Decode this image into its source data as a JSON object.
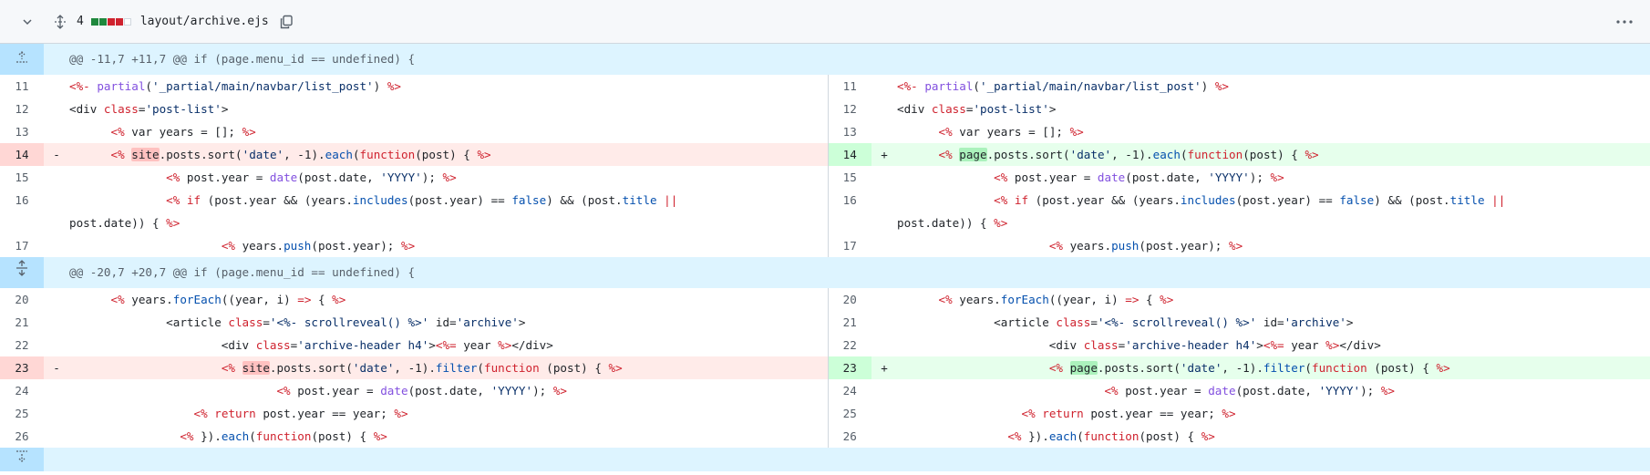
{
  "file": {
    "changes_count": "4",
    "diffstat": [
      "#1f883d",
      "#1f883d",
      "#cf222e",
      "#cf222e",
      "#ffffff"
    ],
    "path": "layout/archive.ejs"
  },
  "colors": {
    "hunk_bg": "#ddf4ff",
    "del_bg": "#ffebe9",
    "add_bg": "#e6ffec",
    "del_num_bg": "#ffd7d5",
    "add_num_bg": "#ccffd8"
  },
  "hunks": [
    {
      "header": "@@ -11,7 +11,7 @@ if (page.menu_id == undefined) {",
      "rows": [
        {
          "type": "ctx",
          "ln": "11",
          "rn": "11",
          "left": [
            [
              "k",
              "<%-"
            ],
            [
              "p",
              " "
            ],
            [
              "f",
              "partial"
            ],
            [
              "p",
              "("
            ],
            [
              "s",
              "'_partial/main/navbar/list_post'"
            ],
            [
              "p",
              ") "
            ],
            [
              "k",
              "%>"
            ]
          ],
          "right": [
            [
              "k",
              "<%-"
            ],
            [
              "p",
              " "
            ],
            [
              "f",
              "partial"
            ],
            [
              "p",
              "("
            ],
            [
              "s",
              "'_partial/main/navbar/list_post'"
            ],
            [
              "p",
              ") "
            ],
            [
              "k",
              "%>"
            ]
          ]
        },
        {
          "type": "ctx",
          "ln": "12",
          "rn": "12",
          "left": [
            [
              "p",
              "<div "
            ],
            [
              "k",
              "class"
            ],
            [
              "p",
              "="
            ],
            [
              "s",
              "'post-list'"
            ],
            [
              "p",
              ">"
            ]
          ],
          "right": [
            [
              "p",
              "<div "
            ],
            [
              "k",
              "class"
            ],
            [
              "p",
              "="
            ],
            [
              "s",
              "'post-list'"
            ],
            [
              "p",
              ">"
            ]
          ]
        },
        {
          "type": "ctx",
          "ln": "13",
          "rn": "13",
          "left": [
            [
              "p",
              "      "
            ],
            [
              "k",
              "<%"
            ],
            [
              "p",
              " var years = []; "
            ],
            [
              "k",
              "%>"
            ]
          ],
          "right": [
            [
              "p",
              "      "
            ],
            [
              "k",
              "<%"
            ],
            [
              "p",
              " var years = []; "
            ],
            [
              "k",
              "%>"
            ]
          ]
        },
        {
          "type": "mod",
          "ln": "14",
          "rn": "14",
          "left": [
            [
              "p",
              "      "
            ],
            [
              "k",
              "<%"
            ],
            [
              "p",
              " "
            ],
            [
              "hd",
              "site"
            ],
            [
              "p",
              ".posts.sort("
            ],
            [
              "s",
              "'date'"
            ],
            [
              "p",
              ", -1)."
            ],
            [
              "c",
              "each"
            ],
            [
              "p",
              "("
            ],
            [
              "k",
              "function"
            ],
            [
              "p",
              "(post) { "
            ],
            [
              "k",
              "%>"
            ]
          ],
          "right": [
            [
              "p",
              "      "
            ],
            [
              "k",
              "<%"
            ],
            [
              "p",
              " "
            ],
            [
              "ha",
              "page"
            ],
            [
              "p",
              ".posts.sort("
            ],
            [
              "s",
              "'date'"
            ],
            [
              "p",
              ", -1)."
            ],
            [
              "c",
              "each"
            ],
            [
              "p",
              "("
            ],
            [
              "k",
              "function"
            ],
            [
              "p",
              "(post) { "
            ],
            [
              "k",
              "%>"
            ]
          ]
        },
        {
          "type": "ctx",
          "ln": "15",
          "rn": "15",
          "left": [
            [
              "p",
              "              "
            ],
            [
              "k",
              "<%"
            ],
            [
              "p",
              " post.year = "
            ],
            [
              "f",
              "date"
            ],
            [
              "p",
              "(post.date, "
            ],
            [
              "s",
              "'YYYY'"
            ],
            [
              "p",
              "); "
            ],
            [
              "k",
              "%>"
            ]
          ],
          "right": [
            [
              "p",
              "              "
            ],
            [
              "k",
              "<%"
            ],
            [
              "p",
              " post.year = "
            ],
            [
              "f",
              "date"
            ],
            [
              "p",
              "(post.date, "
            ],
            [
              "s",
              "'YYYY'"
            ],
            [
              "p",
              "); "
            ],
            [
              "k",
              "%>"
            ]
          ]
        },
        {
          "type": "ctx2",
          "ln": "16",
          "rn": "16",
          "left": [
            [
              "p",
              "              "
            ],
            [
              "k",
              "<%"
            ],
            [
              "p",
              " "
            ],
            [
              "k",
              "if"
            ],
            [
              "p",
              " (post.year && (years."
            ],
            [
              "c",
              "includes"
            ],
            [
              "p",
              "(post.year) == "
            ],
            [
              "c",
              "false"
            ],
            [
              "p",
              ") && (post."
            ],
            [
              "c",
              "title"
            ],
            [
              "p",
              " "
            ],
            [
              "k",
              "||"
            ]
          ],
          "left2": [
            [
              "p",
              "post.date)) { "
            ],
            [
              "k",
              "%>"
            ]
          ],
          "right": [
            [
              "p",
              "              "
            ],
            [
              "k",
              "<%"
            ],
            [
              "p",
              " "
            ],
            [
              "k",
              "if"
            ],
            [
              "p",
              " (post.year && (years."
            ],
            [
              "c",
              "includes"
            ],
            [
              "p",
              "(post.year) == "
            ],
            [
              "c",
              "false"
            ],
            [
              "p",
              ") && (post."
            ],
            [
              "c",
              "title"
            ],
            [
              "p",
              " "
            ],
            [
              "k",
              "||"
            ]
          ],
          "right2": [
            [
              "p",
              "post.date)) { "
            ],
            [
              "k",
              "%>"
            ]
          ]
        },
        {
          "type": "ctx",
          "ln": "17",
          "rn": "17",
          "left": [
            [
              "p",
              "                      "
            ],
            [
              "k",
              "<%"
            ],
            [
              "p",
              " years."
            ],
            [
              "c",
              "push"
            ],
            [
              "p",
              "(post.year); "
            ],
            [
              "k",
              "%>"
            ]
          ],
          "right": [
            [
              "p",
              "                      "
            ],
            [
              "k",
              "<%"
            ],
            [
              "p",
              " years."
            ],
            [
              "c",
              "push"
            ],
            [
              "p",
              "(post.year); "
            ],
            [
              "k",
              "%>"
            ]
          ]
        }
      ]
    },
    {
      "header": "@@ -20,7 +20,7 @@ if (page.menu_id == undefined) {",
      "rows": [
        {
          "type": "ctx",
          "ln": "20",
          "rn": "20",
          "left": [
            [
              "p",
              "      "
            ],
            [
              "k",
              "<%"
            ],
            [
              "p",
              " years."
            ],
            [
              "c",
              "forEach"
            ],
            [
              "p",
              "((year, i) "
            ],
            [
              "k",
              "=>"
            ],
            [
              "p",
              " { "
            ],
            [
              "k",
              "%>"
            ]
          ],
          "right": [
            [
              "p",
              "      "
            ],
            [
              "k",
              "<%"
            ],
            [
              "p",
              " years."
            ],
            [
              "c",
              "forEach"
            ],
            [
              "p",
              "((year, i) "
            ],
            [
              "k",
              "=>"
            ],
            [
              "p",
              " { "
            ],
            [
              "k",
              "%>"
            ]
          ]
        },
        {
          "type": "ctx",
          "ln": "21",
          "rn": "21",
          "left": [
            [
              "p",
              "              <article "
            ],
            [
              "k",
              "class"
            ],
            [
              "p",
              "="
            ],
            [
              "s",
              "'<%- scrollreveal() %>'"
            ],
            [
              "p",
              " id="
            ],
            [
              "s",
              "'archive'"
            ],
            [
              "p",
              ">"
            ]
          ],
          "right": [
            [
              "p",
              "              <article "
            ],
            [
              "k",
              "class"
            ],
            [
              "p",
              "="
            ],
            [
              "s",
              "'<%- scrollreveal() %>'"
            ],
            [
              "p",
              " id="
            ],
            [
              "s",
              "'archive'"
            ],
            [
              "p",
              ">"
            ]
          ]
        },
        {
          "type": "ctx",
          "ln": "22",
          "rn": "22",
          "left": [
            [
              "p",
              "                      <div "
            ],
            [
              "k",
              "class"
            ],
            [
              "p",
              "="
            ],
            [
              "s",
              "'archive-header h4'"
            ],
            [
              "p",
              ">"
            ],
            [
              "k",
              "<%="
            ],
            [
              "p",
              " year "
            ],
            [
              "k",
              "%>"
            ],
            [
              "p",
              "</div>"
            ]
          ],
          "right": [
            [
              "p",
              "                      <div "
            ],
            [
              "k",
              "class"
            ],
            [
              "p",
              "="
            ],
            [
              "s",
              "'archive-header h4'"
            ],
            [
              "p",
              ">"
            ],
            [
              "k",
              "<%="
            ],
            [
              "p",
              " year "
            ],
            [
              "k",
              "%>"
            ],
            [
              "p",
              "</div>"
            ]
          ]
        },
        {
          "type": "mod",
          "ln": "23",
          "rn": "23",
          "left": [
            [
              "p",
              "                      "
            ],
            [
              "k",
              "<%"
            ],
            [
              "p",
              " "
            ],
            [
              "hd",
              "site"
            ],
            [
              "p",
              ".posts.sort("
            ],
            [
              "s",
              "'date'"
            ],
            [
              "p",
              ", -1)."
            ],
            [
              "c",
              "filter"
            ],
            [
              "p",
              "("
            ],
            [
              "k",
              "function"
            ],
            [
              "p",
              " (post) { "
            ],
            [
              "k",
              "%>"
            ]
          ],
          "right": [
            [
              "p",
              "                      "
            ],
            [
              "k",
              "<%"
            ],
            [
              "p",
              " "
            ],
            [
              "ha",
              "page"
            ],
            [
              "p",
              ".posts.sort("
            ],
            [
              "s",
              "'date'"
            ],
            [
              "p",
              ", -1)."
            ],
            [
              "c",
              "filter"
            ],
            [
              "p",
              "("
            ],
            [
              "k",
              "function"
            ],
            [
              "p",
              " (post) { "
            ],
            [
              "k",
              "%>"
            ]
          ]
        },
        {
          "type": "ctx",
          "ln": "24",
          "rn": "24",
          "left": [
            [
              "p",
              "                              "
            ],
            [
              "k",
              "<%"
            ],
            [
              "p",
              " post.year = "
            ],
            [
              "f",
              "date"
            ],
            [
              "p",
              "(post.date, "
            ],
            [
              "s",
              "'YYYY'"
            ],
            [
              "p",
              "); "
            ],
            [
              "k",
              "%>"
            ]
          ],
          "right": [
            [
              "p",
              "                              "
            ],
            [
              "k",
              "<%"
            ],
            [
              "p",
              " post.year = "
            ],
            [
              "f",
              "date"
            ],
            [
              "p",
              "(post.date, "
            ],
            [
              "s",
              "'YYYY'"
            ],
            [
              "p",
              "); "
            ],
            [
              "k",
              "%>"
            ]
          ]
        },
        {
          "type": "ctx",
          "ln": "25",
          "rn": "25",
          "left": [
            [
              "p",
              "                  "
            ],
            [
              "k",
              "<%"
            ],
            [
              "p",
              " "
            ],
            [
              "k",
              "return"
            ],
            [
              "p",
              " post.year == year; "
            ],
            [
              "k",
              "%>"
            ]
          ],
          "right": [
            [
              "p",
              "                  "
            ],
            [
              "k",
              "<%"
            ],
            [
              "p",
              " "
            ],
            [
              "k",
              "return"
            ],
            [
              "p",
              " post.year == year; "
            ],
            [
              "k",
              "%>"
            ]
          ]
        },
        {
          "type": "ctx",
          "ln": "26",
          "rn": "26",
          "left": [
            [
              "p",
              "                "
            ],
            [
              "k",
              "<%"
            ],
            [
              "p",
              " })."
            ],
            [
              "c",
              "each"
            ],
            [
              "p",
              "("
            ],
            [
              "k",
              "function"
            ],
            [
              "p",
              "(post) { "
            ],
            [
              "k",
              "%>"
            ]
          ],
          "right": [
            [
              "p",
              "                "
            ],
            [
              "k",
              "<%"
            ],
            [
              "p",
              " })."
            ],
            [
              "c",
              "each"
            ],
            [
              "p",
              "("
            ],
            [
              "k",
              "function"
            ],
            [
              "p",
              "(post) { "
            ],
            [
              "k",
              "%>"
            ]
          ]
        }
      ]
    }
  ],
  "markers": {
    "del": "-",
    "add": "+"
  }
}
